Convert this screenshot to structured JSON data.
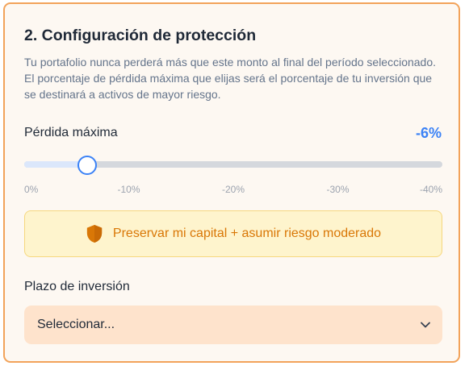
{
  "section": {
    "title": "2. Configuración de protección",
    "description": "Tu portafolio nunca perderá más que este monto al final del período seleccionado. El porcentaje de pérdida máxima que elijas será el porcentaje de tu inversión que se destinará a activos de mayor riesgo."
  },
  "max_loss": {
    "label": "Pérdida máxima",
    "value_text": "-6%",
    "value_percent": -6,
    "range_min": 0,
    "range_max": -40,
    "ticks": [
      "0%",
      "-10%",
      "-20%",
      "-30%",
      "-40%"
    ],
    "accent_color": "#3b82f6"
  },
  "notice": {
    "icon": "shield-icon",
    "text": "Preservar mi capital + asumir riesgo moderado",
    "color": "#d97706"
  },
  "term": {
    "label": "Plazo de inversión",
    "selected": "Seleccionar...",
    "icon": "chevron-down-icon"
  },
  "colors": {
    "card_border": "#f2a35a",
    "notice_background": "#fef4cd",
    "select_background": "#fee3cc"
  }
}
